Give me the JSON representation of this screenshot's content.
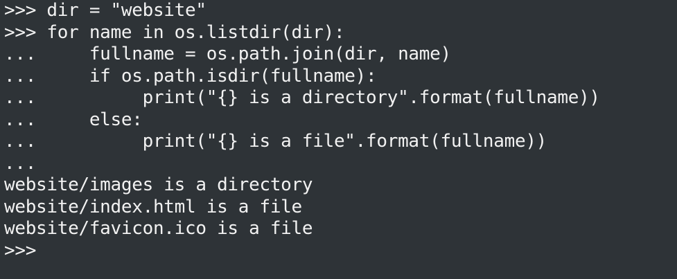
{
  "terminal": {
    "lines": [
      ">>> dir = \"website\"",
      ">>> for name in os.listdir(dir):",
      "...     fullname = os.path.join(dir, name)",
      "...     if os.path.isdir(fullname):",
      "...          print(\"{} is a directory\".format(fullname))",
      "...     else:",
      "...          print(\"{} is a file\".format(fullname))",
      "...",
      "website/images is a directory",
      "website/index.html is a file",
      "website/favicon.ico is a file",
      ">>>"
    ]
  },
  "colors": {
    "background": "#2e3337",
    "foreground": "#f2f2f2"
  }
}
